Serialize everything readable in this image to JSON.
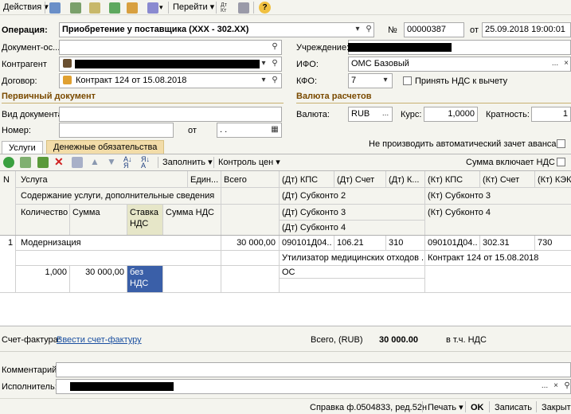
{
  "toolbar": {
    "actions_label": "Действия",
    "goto_label": "Перейти"
  },
  "header": {
    "operation_label": "Операция:",
    "operation_value": "Приобретение у поставщика (XXX - 302.XX)",
    "number_label": "№",
    "number_value": "00000387",
    "date_label": "от",
    "date_value": "25.09.2018 19:00:01",
    "document_label": "Документ-ос...",
    "institution_label": "Учреждение:",
    "contractor_label": "Контрагент",
    "ifo_label": "ИФО:",
    "ifo_value": "ОМС Базовый",
    "contract_label": "Договор:",
    "contract_value": "Контракт 124 от 15.08.2018",
    "kfo_label": "КФО:",
    "kfo_value": "7",
    "vat_deduct_label": "Принять НДС к вычету"
  },
  "primary": {
    "title": "Первичный документ",
    "doc_type_label": "Вид документа:",
    "number_label": "Номер:",
    "date_label": "от",
    "date_value": " .  ."
  },
  "currency": {
    "title": "Валюта расчетов",
    "currency_label": "Валюта:",
    "currency_value": "RUB",
    "rate_label": "Курс:",
    "rate_value": "1,0000",
    "multiplicity_label": "Кратность:",
    "multiplicity_value": "1"
  },
  "no_auto_offset_label": "Не производить автоматический зачет аванса",
  "tabs": [
    "Услуги",
    "Денежные обязательства"
  ],
  "grid_toolbar": {
    "fill_label": "Заполнить",
    "price_control_label": "Контроль цен",
    "sum_includes_vat_label": "Сумма включает НДС"
  },
  "columns": {
    "n": "N",
    "service": "Услуга",
    "unit": "Един...",
    "total": "Всего",
    "dt_kps": "(Дт) КПС",
    "dt_account": "(Дт) Счет",
    "dt_k": "(Дт) К...",
    "kt_kps": "(Кт) КПС",
    "kt_account": "(Кт) Счет",
    "kt_kek": "(Кт) КЭК",
    "content": "Содержание услуги, дополнительные сведения",
    "dt_sub2": "(Дт) Субконто 2",
    "kt_sub3": "(Кт) Субконто 3",
    "quantity": "Количество",
    "sum": "Сумма",
    "vat_rate": "Ставка НДС",
    "vat_sum": "Сумма НДС",
    "dt_sub3": "(Дт) Субконто 3",
    "kt_sub4": "(Кт) Субконто 4",
    "dt_sub4": "(Дт) Субконто 4"
  },
  "row": {
    "n": "1",
    "service": "Модернизация",
    "total": "30 000,00",
    "dt_kps": "090101Д04...",
    "dt_account": "106.21",
    "dt_k": "310",
    "kt_kps": "090101Д04...",
    "kt_account": "302.31",
    "kt_kek": "730",
    "dt_sub2": "Утилизатор медицинских отходов ...",
    "kt_sub3": "Контракт 124 от 15.08.2018",
    "quantity": "1,000",
    "sum": "30 000,00",
    "vat_rate": "без НДС",
    "dt_sub3": "ОС"
  },
  "footer": {
    "invoice_label": "Счет-фактура:",
    "invoice_link": "Ввести счет-фактуру",
    "total_label": "Всего, (RUB)",
    "total_value": "30 000.00",
    "vat_label": "в т.ч. НДС",
    "comment_label": "Комментарий:",
    "executor_label": "Исполнитель:"
  },
  "bottom_bar": {
    "report_label": "Справка ф.0504833, ред.52н",
    "print_label": "Печать",
    "ok_label": "OK",
    "save_label": "Записать",
    "close_label": "Закрыть"
  }
}
